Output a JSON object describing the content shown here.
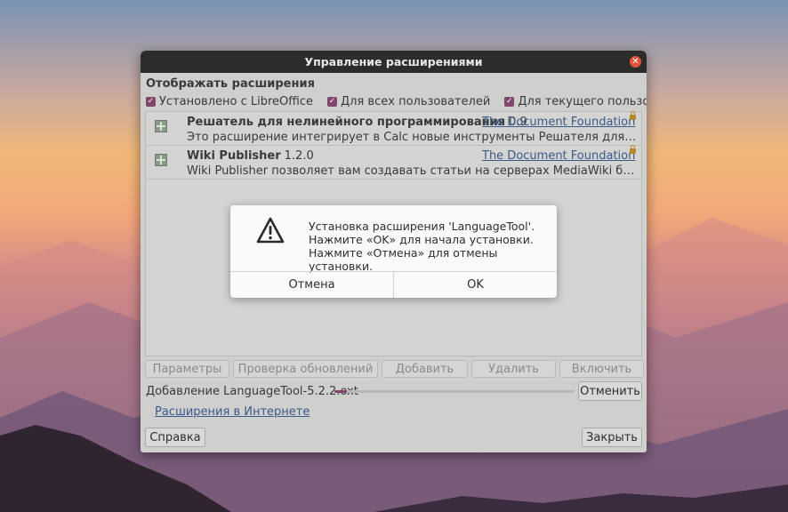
{
  "window": {
    "title": "Управление расширениями"
  },
  "filters": {
    "title": "Отображать расширения",
    "options": [
      {
        "label": "Установлено с LibreOffice",
        "checked": true
      },
      {
        "label": "Для всех пользователей",
        "checked": true
      },
      {
        "label": "Для текущего пользователя",
        "checked": true
      }
    ]
  },
  "extensions": [
    {
      "name": "Решатель для нелинейного программирования",
      "version": "0.9",
      "publisher": "The Document Foundation",
      "description": "Это расширение интегрирует в Calc новые инструменты Решателя для оптимизац..."
    },
    {
      "name": "Wiki Publisher",
      "version": "1.2.0",
      "publisher": "The Document Foundation",
      "description": "Wiki Publisher позволяет вам создавать статьи на серверах MediaWiki без знания я..."
    }
  ],
  "toolbar": {
    "options": "Параметры",
    "check_updates": "Проверка обновлений",
    "add": "Добавить",
    "remove": "Удалить",
    "enable": "Включить"
  },
  "progress": {
    "label": "Добавление LanguageTool-5.2.2.oxt",
    "fraction": 0.05,
    "cancel": "Отменить"
  },
  "online_link": "Расширения в Интернете",
  "footer": {
    "help": "Справка",
    "close": "Закрыть"
  },
  "dialog": {
    "lines": [
      "Установка расширения 'LanguageTool'.",
      "Нажмите «OK» для начала установки.",
      "Нажмите «Отмена» для отмены установки."
    ],
    "cancel": "Отмена",
    "ok": "OK"
  },
  "colors": {
    "accent": "#82466a",
    "link": "#3a5a88",
    "titlebar": "#2c2c2c"
  }
}
